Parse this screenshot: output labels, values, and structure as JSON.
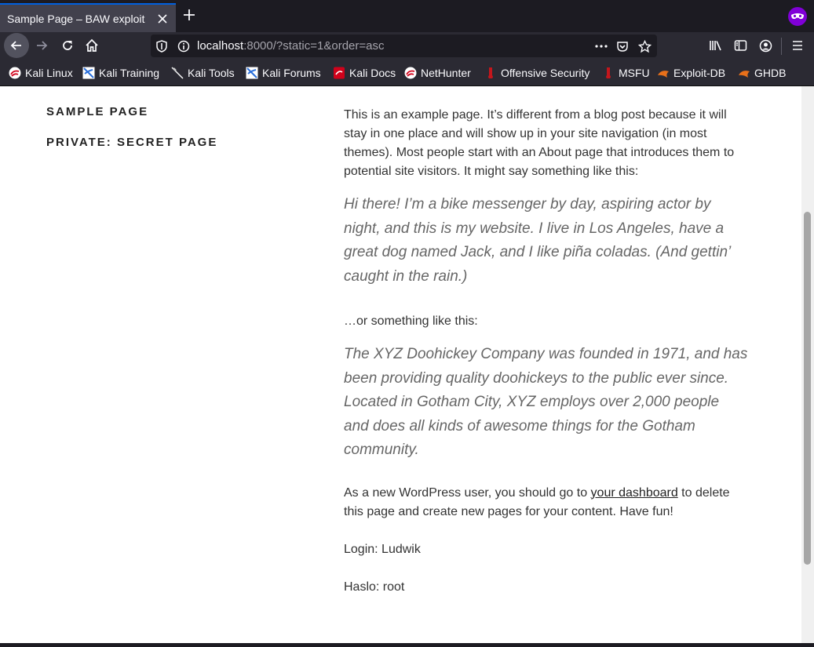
{
  "browser": {
    "tab": {
      "title": "Sample Page – BAW exploit"
    },
    "url": {
      "host": "localhost",
      "rest": ":8000/?static=1&order=asc"
    },
    "bookmarks": [
      {
        "label": "Kali Linux",
        "icon": "kali-icon"
      },
      {
        "label": "Kali Training",
        "icon": "kali-training-icon"
      },
      {
        "label": "Kali Tools",
        "icon": "kali-tools-icon"
      },
      {
        "label": "Kali Forums",
        "icon": "kali-forums-icon"
      },
      {
        "label": "Kali Docs",
        "icon": "kali-docs-icon"
      },
      {
        "label": "NetHunter",
        "icon": "nethunter-icon"
      },
      {
        "label": "Offensive Security",
        "icon": "offsec-icon"
      },
      {
        "label": "MSFU",
        "icon": "msfu-icon"
      },
      {
        "label": "Exploit-DB",
        "icon": "exploitdb-icon"
      },
      {
        "label": "GHDB",
        "icon": "ghdb-icon"
      }
    ],
    "colors": {
      "chrome": "#2b2a33",
      "tabstrip": "#1c1b22",
      "accent": "#0060df",
      "private": "#8000d7"
    }
  },
  "page": {
    "menu": [
      "Sample Page",
      "Private: Secret Page"
    ],
    "intro": "This is an example page. It’s different from a blog post because it will stay in one place and will show up in your site navigation (in most themes). Most people start with an About page that introduces them to potential site visitors. It might say something like this:",
    "quote1": "Hi there! I’m a bike messenger by day, aspiring actor by night, and this is my website. I live in Los Angeles, have a great dog named Jack, and I like piña coladas. (And gettin’ caught in the rain.)",
    "or_text": "…or something like this:",
    "quote2": "The XYZ Doohickey Company was founded in 1971, and has been providing quality doohickeys to the public ever since. Located in Gotham City, XYZ employs over 2,000 people and does all kinds of awesome things for the Gotham community.",
    "outro_before": "As a new WordPress user, you should go to ",
    "dashboard_link": "your dashboard",
    "outro_after": " to delete this page and create new pages for your content. Have fun!",
    "login": "Login: Ludwik",
    "password": "Haslo: root"
  }
}
